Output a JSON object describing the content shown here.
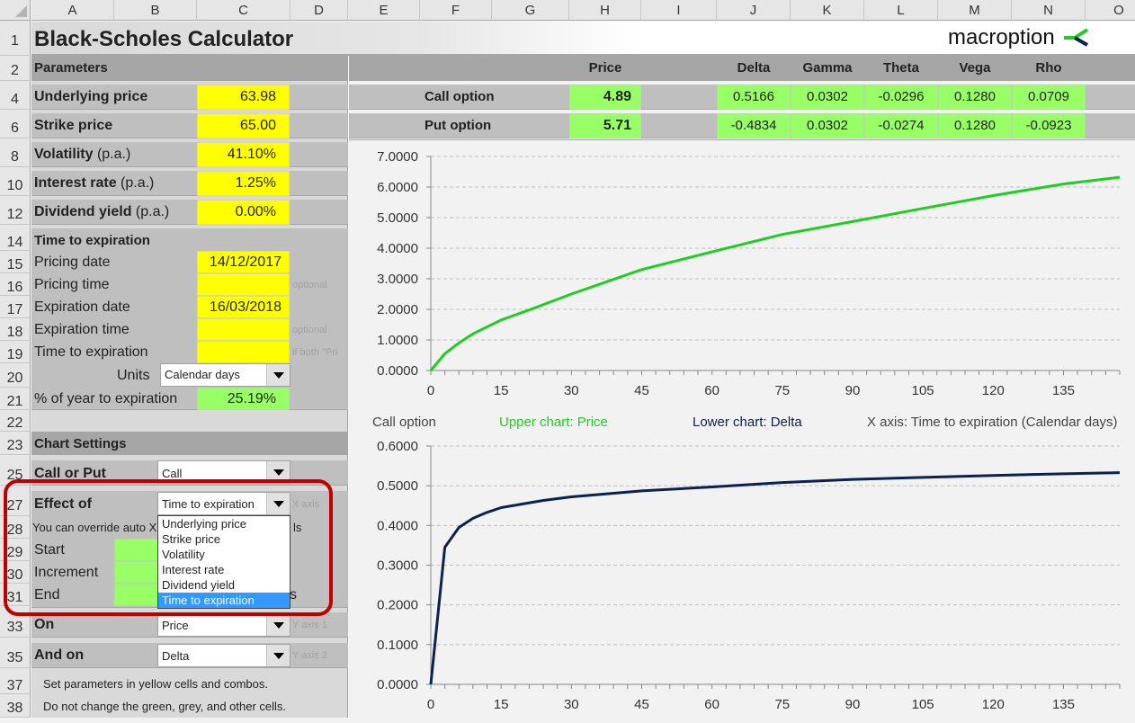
{
  "columns": [
    "A",
    "B",
    "C",
    "D",
    "E",
    "F",
    "G",
    "H",
    "I",
    "J",
    "K",
    "L",
    "M",
    "N",
    "O"
  ],
  "rows": [
    "1",
    "2",
    "4",
    "6",
    "8",
    "10",
    "12",
    "14",
    "15",
    "16",
    "17",
    "18",
    "19",
    "20",
    "21",
    "22",
    "23",
    "25",
    "27",
    "28",
    "29",
    "30",
    "31",
    "33",
    "35",
    "37",
    "38"
  ],
  "title": "Black-Scholes Calculator",
  "logo": {
    "text": "macroption",
    "icon": "macroption-arrow-icon",
    "green": "#22cc22",
    "navy": "#0b2150"
  },
  "parameters": {
    "header": "Parameters",
    "underlying_label": "Underlying price",
    "underlying_value": "63.98",
    "strike_label": "Strike price",
    "strike_value": "65.00",
    "volatility_label": "Volatility",
    "volatility_suffix": " (p.a.)",
    "volatility_value": "41.10%",
    "interest_label": "Interest rate",
    "interest_suffix": " (p.a.)",
    "interest_value": "1.25%",
    "dividend_label": "Dividend yield",
    "dividend_suffix": " (p.a.)",
    "dividend_value": "0.00%"
  },
  "time": {
    "header": "Time to expiration",
    "pricing_date_label": "Pricing date",
    "pricing_date_value": "14/12/2017",
    "pricing_time_label": "Pricing time",
    "pricing_time_value": "",
    "pricing_time_note": "optional",
    "expiration_date_label": "Expiration date",
    "expiration_date_value": "16/03/2018",
    "expiration_time_label": "Expiration time",
    "expiration_time_value": "",
    "expiration_time_note": "optional",
    "tte_label": "Time to expiration",
    "tte_value": "",
    "tte_note": "if both \"Pri",
    "units_label": "Units",
    "units_value": "Calendar days",
    "pct_year_label": "% of year to expiration",
    "pct_year_value": "25.19%"
  },
  "chart_settings": {
    "header": "Chart Settings",
    "call_put_label": "Call or Put",
    "call_put_value": "Call",
    "effect_label": "Effect of",
    "effect_value": "Time to expiration",
    "effect_note": "X axis",
    "override_text": "You can override auto X",
    "override_tail": "ls",
    "start_label": "Start",
    "increment_label": "Increment",
    "end_label": "End",
    "end_tail": "s",
    "on_label": "On",
    "on_value": "Price",
    "on_note": "Y axis 1",
    "andon_label": "And on",
    "andon_value": "Delta",
    "andon_note": "Y axis 2",
    "dropdown_options": [
      "Underlying price",
      "Strike price",
      "Volatility",
      "Interest rate",
      "Dividend yield",
      "Time to expiration"
    ],
    "dropdown_selected": "Time to expiration"
  },
  "instructions": [
    "Set parameters in yellow cells and combos.",
    "Do not change the green, grey, and other cells."
  ],
  "results": {
    "headers": {
      "price": "Price",
      "delta": "Delta",
      "gamma": "Gamma",
      "theta": "Theta",
      "vega": "Vega",
      "rho": "Rho"
    },
    "call": {
      "label": "Call option",
      "price": "4.89",
      "delta": "0.5166",
      "gamma": "0.0302",
      "theta": "-0.0296",
      "vega": "0.1280",
      "rho": "0.0709"
    },
    "put": {
      "label": "Put option",
      "price": "5.71",
      "delta": "-0.4834",
      "gamma": "0.0302",
      "theta": "-0.0274",
      "vega": "0.1280",
      "rho": "-0.0923"
    }
  },
  "chart_legend": {
    "option": "Call option",
    "upper": "Upper chart: Price",
    "lower": "Lower chart: Delta",
    "xaxis": "X axis: Time to expiration (Calendar days)",
    "upper_color": "#22cc22",
    "lower_color": "#0b2150"
  },
  "chart_data": [
    {
      "type": "line",
      "title": "Upper chart: Price",
      "xlabel": "Time to expiration (Calendar days)",
      "ylabel": "Price",
      "xlim": [
        0,
        147
      ],
      "ylim": [
        0,
        7
      ],
      "xticks": [
        0,
        15,
        30,
        45,
        60,
        75,
        90,
        105,
        120,
        135
      ],
      "yticks": [
        "0.0000",
        "1.0000",
        "2.0000",
        "3.0000",
        "4.0000",
        "5.0000",
        "6.0000",
        "7.0000"
      ],
      "grid": true,
      "color": "#22cc22",
      "x": [
        0,
        3,
        6,
        9,
        15,
        21,
        30,
        45,
        60,
        75,
        90,
        105,
        120,
        135,
        147
      ],
      "y": [
        0,
        0.55,
        0.9,
        1.2,
        1.65,
        1.98,
        2.5,
        3.3,
        3.88,
        4.45,
        4.87,
        5.3,
        5.72,
        6.1,
        6.32
      ]
    },
    {
      "type": "line",
      "title": "Lower chart: Delta",
      "xlabel": "Time to expiration (Calendar days)",
      "ylabel": "Delta",
      "xlim": [
        0,
        147
      ],
      "ylim": [
        0,
        0.6
      ],
      "xticks": [
        0,
        15,
        30,
        45,
        60,
        75,
        90,
        105,
        120,
        135
      ],
      "yticks": [
        "0.0000",
        "0.1000",
        "0.2000",
        "0.3000",
        "0.4000",
        "0.5000",
        "0.6000"
      ],
      "grid": true,
      "color": "#0b2150",
      "x": [
        0,
        3,
        6,
        9,
        12,
        15,
        24,
        30,
        45,
        60,
        75,
        90,
        105,
        120,
        135,
        147
      ],
      "y": [
        0,
        0.345,
        0.395,
        0.418,
        0.433,
        0.445,
        0.463,
        0.472,
        0.487,
        0.497,
        0.508,
        0.516,
        0.521,
        0.526,
        0.53,
        0.533
      ]
    }
  ]
}
